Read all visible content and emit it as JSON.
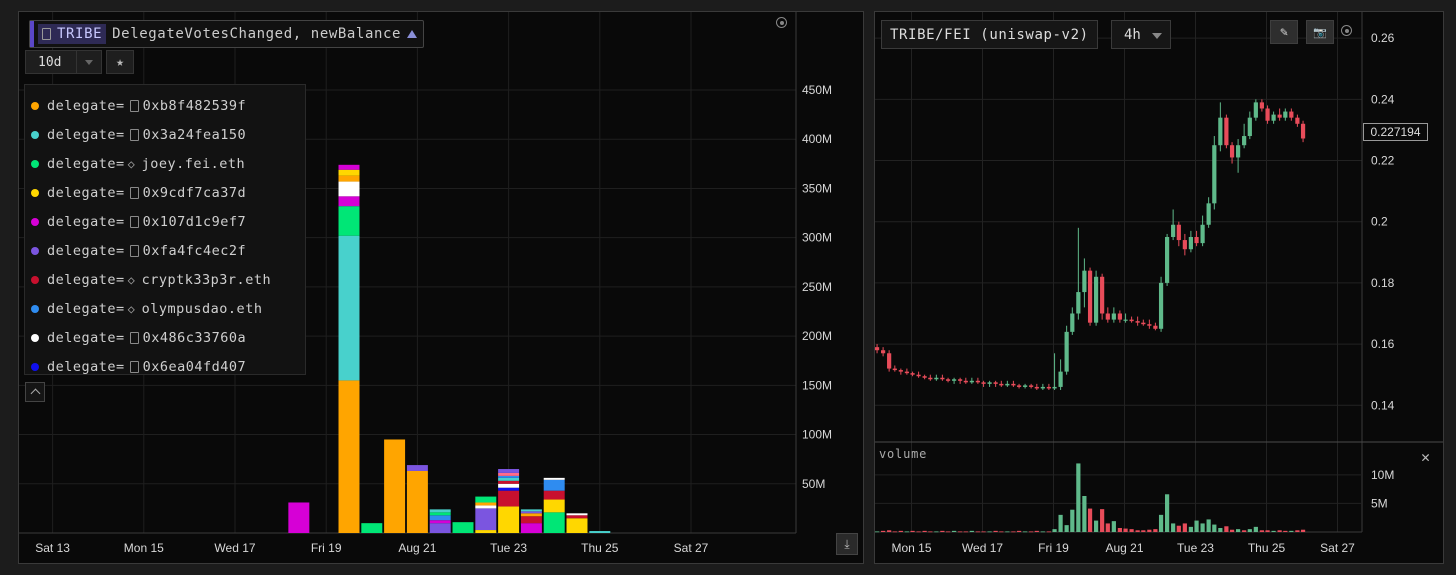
{
  "left": {
    "title": {
      "token": "TRIBE",
      "event": "DelegateVotesChanged, newBalance"
    },
    "range": "10d",
    "legend": [
      {
        "prefix": "delegate=",
        "icon": "file",
        "label": "0xb8f482539f",
        "color": "#ffa500"
      },
      {
        "prefix": "delegate=",
        "icon": "file",
        "label": "0x3a24fea150",
        "color": "#48d1cc"
      },
      {
        "prefix": "delegate=",
        "icon": "code",
        "label": "joey.fei.eth",
        "color": "#00e676"
      },
      {
        "prefix": "delegate=",
        "icon": "file",
        "label": "0x9cdf7ca37d",
        "color": "#ffd700"
      },
      {
        "prefix": "delegate=",
        "icon": "file",
        "label": "0x107d1c9ef7",
        "color": "#d600d6"
      },
      {
        "prefix": "delegate=",
        "icon": "file",
        "label": "0xfa4fc4ec2f",
        "color": "#7b55e0"
      },
      {
        "prefix": "delegate=",
        "icon": "code",
        "label": "cryptk33p3r.eth",
        "color": "#c8102e"
      },
      {
        "prefix": "delegate=",
        "icon": "code",
        "label": "olympusdao.eth",
        "color": "#2f8cf0"
      },
      {
        "prefix": "delegate=",
        "icon": "file",
        "label": "0x486c33760a",
        "color": "#ffffff"
      },
      {
        "prefix": "delegate=",
        "icon": "file",
        "label": "0x6ea04fd407",
        "color": "#1010ee"
      }
    ]
  },
  "right": {
    "pair": "TRIBE/FEI (uniswap-v2)",
    "timeframe": "4h",
    "last_price": "0.227194",
    "volume_label": "volume"
  },
  "chart_data": [
    {
      "type": "bar",
      "stacked": true,
      "x_ticks": [
        "Sat 13",
        "Mon 15",
        "Wed 17",
        "Fri 19",
        "Aug 21",
        "Tue 23",
        "Thu 25",
        "Sat 27"
      ],
      "y_ticks": [
        "50M",
        "100M",
        "150M",
        "200M",
        "250M",
        "300M",
        "350M",
        "400M",
        "450M"
      ],
      "ylim": [
        0,
        450
      ],
      "y_unit": "M",
      "xlim": [
        12,
        28
      ],
      "bar_width_days": 0.46,
      "bars": [
        {
          "x": 18.4,
          "stack": [
            [
              "#d600d6",
              31
            ]
          ]
        },
        {
          "x": 19.5,
          "stack": [
            [
              "#ffa500",
              155
            ],
            [
              "#48d1cc",
              147
            ],
            [
              "#00e676",
              30
            ],
            [
              "#d600d6",
              10
            ],
            [
              "#ffffff",
              15
            ],
            [
              "#ffa500",
              6
            ],
            [
              "#ffd700",
              6
            ],
            [
              "#d600d6",
              5
            ]
          ]
        },
        {
          "x": 20.0,
          "stack": [
            [
              "#00e676",
              10
            ]
          ]
        },
        {
          "x": 20.5,
          "stack": [
            [
              "#ffa500",
              95
            ]
          ]
        },
        {
          "x": 21.0,
          "stack": [
            [
              "#ffa500",
              63
            ],
            [
              "#7b55e0",
              6
            ]
          ]
        },
        {
          "x": 21.5,
          "stack": [
            [
              "#7b55e0",
              10
            ],
            [
              "#d600d6",
              3
            ],
            [
              "#2f8cf0",
              5
            ],
            [
              "#00e676",
              3
            ],
            [
              "#48d1cc",
              3
            ]
          ]
        },
        {
          "x": 22.0,
          "stack": [
            [
              "#00e676",
              11
            ]
          ]
        },
        {
          "x": 22.5,
          "stack": [
            [
              "#ffd700",
              3
            ],
            [
              "#7b55e0",
              22
            ],
            [
              "#ffffff",
              3
            ],
            [
              "#ffa500",
              3
            ],
            [
              "#00e676",
              6
            ]
          ]
        },
        {
          "x": 23.0,
          "stack": [
            [
              "#ffd700",
              27
            ],
            [
              "#c8102e",
              16
            ],
            [
              "#1010ee",
              3
            ],
            [
              "#ffffff",
              4
            ],
            [
              "#c8102e",
              3
            ],
            [
              "#48d1cc",
              3
            ],
            [
              "#2f8cf0",
              2
            ],
            [
              "#ff6b8b",
              3
            ],
            [
              "#7b55e0",
              4
            ]
          ]
        },
        {
          "x": 23.5,
          "stack": [
            [
              "#d600d6",
              10
            ],
            [
              "#c8102e",
              7
            ],
            [
              "#ffa500",
              3
            ],
            [
              "#7b55e0",
              2
            ],
            [
              "#48d1cc",
              2
            ]
          ]
        },
        {
          "x": 24.0,
          "stack": [
            [
              "#00e676",
              21
            ],
            [
              "#ffd700",
              13
            ],
            [
              "#c8102e",
              9
            ],
            [
              "#2f8cf0",
              11
            ],
            [
              "#ffffff",
              2
            ]
          ]
        },
        {
          "x": 24.5,
          "stack": [
            [
              "#ffd700",
              15
            ],
            [
              "#c8102e",
              3
            ],
            [
              "#ffffff",
              2
            ]
          ]
        },
        {
          "x": 25.0,
          "stack": [
            [
              "#48d1cc",
              2
            ]
          ]
        }
      ]
    },
    {
      "type": "candlestick",
      "x_ticks": [
        "Mon 15",
        "Wed 17",
        "Fri 19",
        "Aug 21",
        "Tue 23",
        "Thu 25",
        "Sat 27"
      ],
      "y_ticks": [
        0.14,
        0.16,
        0.18,
        0.2,
        0.22,
        0.24,
        0.26
      ],
      "ylim": [
        0.128,
        0.262
      ],
      "xlim": [
        14,
        27.72
      ],
      "last_price": 0.227194,
      "up_color": "#5fb98a",
      "down_color": "#e84c5a",
      "candles": [
        [
          14.03,
          0.159,
          0.158,
          0.16,
          0.157
        ],
        [
          14.2,
          0.158,
          0.157,
          0.159,
          0.156
        ],
        [
          14.37,
          0.157,
          0.152,
          0.158,
          0.151
        ],
        [
          14.53,
          0.152,
          0.1515,
          0.153,
          0.151
        ],
        [
          14.7,
          0.1515,
          0.151,
          0.152,
          0.15
        ],
        [
          14.87,
          0.151,
          0.1505,
          0.152,
          0.15
        ],
        [
          15.03,
          0.1505,
          0.15,
          0.151,
          0.1495
        ],
        [
          15.2,
          0.15,
          0.1495,
          0.151,
          0.149
        ],
        [
          15.37,
          0.1495,
          0.149,
          0.15,
          0.1485
        ],
        [
          15.53,
          0.149,
          0.1485,
          0.15,
          0.148
        ],
        [
          15.7,
          0.1485,
          0.149,
          0.15,
          0.148
        ],
        [
          15.87,
          0.149,
          0.1485,
          0.15,
          0.148
        ],
        [
          16.03,
          0.1485,
          0.148,
          0.149,
          0.1475
        ],
        [
          16.2,
          0.148,
          0.1485,
          0.149,
          0.147
        ],
        [
          16.37,
          0.1485,
          0.148,
          0.149,
          0.147
        ],
        [
          16.53,
          0.148,
          0.1475,
          0.149,
          0.147
        ],
        [
          16.7,
          0.1475,
          0.148,
          0.149,
          0.147
        ],
        [
          16.87,
          0.148,
          0.1475,
          0.149,
          0.147
        ],
        [
          17.03,
          0.1475,
          0.147,
          0.148,
          0.146
        ],
        [
          17.2,
          0.147,
          0.1475,
          0.148,
          0.146
        ],
        [
          17.37,
          0.1475,
          0.147,
          0.148,
          0.146
        ],
        [
          17.53,
          0.147,
          0.1465,
          0.148,
          0.146
        ],
        [
          17.7,
          0.1465,
          0.147,
          0.148,
          0.146
        ],
        [
          17.87,
          0.147,
          0.1465,
          0.148,
          0.146
        ],
        [
          18.03,
          0.1465,
          0.146,
          0.147,
          0.1455
        ],
        [
          18.2,
          0.146,
          0.1465,
          0.147,
          0.1455
        ],
        [
          18.37,
          0.1465,
          0.146,
          0.147,
          0.1455
        ],
        [
          18.53,
          0.146,
          0.1455,
          0.147,
          0.145
        ],
        [
          18.7,
          0.1455,
          0.146,
          0.147,
          0.145
        ],
        [
          18.87,
          0.146,
          0.1455,
          0.147,
          0.145
        ],
        [
          19.03,
          0.1455,
          0.146,
          0.157,
          0.145
        ],
        [
          19.2,
          0.146,
          0.151,
          0.155,
          0.145
        ],
        [
          19.37,
          0.151,
          0.164,
          0.166,
          0.15
        ],
        [
          19.53,
          0.164,
          0.17,
          0.172,
          0.163
        ],
        [
          19.7,
          0.17,
          0.177,
          0.198,
          0.168
        ],
        [
          19.87,
          0.177,
          0.184,
          0.188,
          0.172
        ],
        [
          20.03,
          0.184,
          0.167,
          0.185,
          0.166
        ],
        [
          20.2,
          0.167,
          0.182,
          0.184,
          0.166
        ],
        [
          20.37,
          0.182,
          0.17,
          0.183,
          0.168
        ],
        [
          20.53,
          0.17,
          0.168,
          0.172,
          0.167
        ],
        [
          20.7,
          0.168,
          0.17,
          0.172,
          0.167
        ],
        [
          20.87,
          0.17,
          0.168,
          0.171,
          0.167
        ],
        [
          21.03,
          0.168,
          0.168,
          0.17,
          0.167
        ],
        [
          21.2,
          0.168,
          0.1675,
          0.169,
          0.167
        ],
        [
          21.37,
          0.1675,
          0.167,
          0.169,
          0.166
        ],
        [
          21.53,
          0.167,
          0.1665,
          0.168,
          0.166
        ],
        [
          21.7,
          0.1665,
          0.166,
          0.168,
          0.165
        ],
        [
          21.87,
          0.166,
          0.165,
          0.167,
          0.1645
        ],
        [
          22.03,
          0.165,
          0.18,
          0.182,
          0.164
        ],
        [
          22.2,
          0.18,
          0.195,
          0.196,
          0.179
        ],
        [
          22.37,
          0.195,
          0.199,
          0.204,
          0.194
        ],
        [
          22.53,
          0.199,
          0.194,
          0.2,
          0.192
        ],
        [
          22.7,
          0.194,
          0.191,
          0.196,
          0.189
        ],
        [
          22.87,
          0.191,
          0.195,
          0.197,
          0.19
        ],
        [
          23.03,
          0.195,
          0.193,
          0.197,
          0.192
        ],
        [
          23.2,
          0.193,
          0.199,
          0.202,
          0.192
        ],
        [
          23.37,
          0.199,
          0.206,
          0.208,
          0.198
        ],
        [
          23.53,
          0.206,
          0.225,
          0.228,
          0.204
        ],
        [
          23.7,
          0.225,
          0.234,
          0.239,
          0.223
        ],
        [
          23.87,
          0.234,
          0.225,
          0.235,
          0.224
        ],
        [
          24.03,
          0.225,
          0.221,
          0.226,
          0.219
        ],
        [
          24.2,
          0.221,
          0.225,
          0.227,
          0.216
        ],
        [
          24.37,
          0.225,
          0.228,
          0.232,
          0.224
        ],
        [
          24.53,
          0.228,
          0.234,
          0.236,
          0.227
        ],
        [
          24.7,
          0.234,
          0.239,
          0.24,
          0.233
        ],
        [
          24.87,
          0.239,
          0.237,
          0.24,
          0.236
        ],
        [
          25.03,
          0.237,
          0.233,
          0.238,
          0.232
        ],
        [
          25.2,
          0.233,
          0.235,
          0.236,
          0.232
        ],
        [
          25.37,
          0.235,
          0.234,
          0.237,
          0.233
        ],
        [
          25.53,
          0.234,
          0.236,
          0.237,
          0.233
        ],
        [
          25.7,
          0.236,
          0.234,
          0.237,
          0.233
        ],
        [
          25.87,
          0.234,
          0.232,
          0.235,
          0.231
        ],
        [
          26.03,
          0.232,
          0.2272,
          0.233,
          0.226
        ]
      ]
    },
    {
      "type": "bar",
      "title": "volume",
      "y_ticks": [
        "5M",
        "10M"
      ],
      "ylim": [
        0,
        14
      ],
      "y_unit": "M",
      "xlim": [
        14,
        27.72
      ],
      "bars": [
        [
          14.03,
          0.1,
          0
        ],
        [
          14.2,
          0.2,
          1
        ],
        [
          14.37,
          0.3,
          1
        ],
        [
          14.53,
          0.1,
          1
        ],
        [
          14.7,
          0.2,
          1
        ],
        [
          14.87,
          0.1,
          0
        ],
        [
          15.03,
          0.2,
          1
        ],
        [
          15.2,
          0.1,
          1
        ],
        [
          15.37,
          0.2,
          1
        ],
        [
          15.53,
          0.1,
          1
        ],
        [
          15.7,
          0.1,
          0
        ],
        [
          15.87,
          0.2,
          1
        ],
        [
          16.03,
          0.1,
          1
        ],
        [
          16.2,
          0.2,
          0
        ],
        [
          16.37,
          0.1,
          1
        ],
        [
          16.53,
          0.1,
          1
        ],
        [
          16.7,
          0.2,
          0
        ],
        [
          16.87,
          0.1,
          1
        ],
        [
          17.03,
          0.1,
          1
        ],
        [
          17.2,
          0.1,
          0
        ],
        [
          17.37,
          0.2,
          1
        ],
        [
          17.53,
          0.1,
          1
        ],
        [
          17.7,
          0.1,
          0
        ],
        [
          17.87,
          0.1,
          1
        ],
        [
          18.03,
          0.2,
          1
        ],
        [
          18.2,
          0.1,
          0
        ],
        [
          18.37,
          0.1,
          1
        ],
        [
          18.53,
          0.2,
          1
        ],
        [
          18.7,
          0.1,
          0
        ],
        [
          18.87,
          0.1,
          1
        ],
        [
          19.03,
          0.5,
          0
        ],
        [
          19.2,
          3.0,
          0
        ],
        [
          19.37,
          1.2,
          0
        ],
        [
          19.53,
          3.9,
          0
        ],
        [
          19.7,
          12.0,
          0
        ],
        [
          19.87,
          6.3,
          0
        ],
        [
          20.03,
          4.1,
          1
        ],
        [
          20.2,
          2.0,
          0
        ],
        [
          20.37,
          4.0,
          1
        ],
        [
          20.53,
          1.5,
          1
        ],
        [
          20.7,
          1.9,
          0
        ],
        [
          20.87,
          0.7,
          1
        ],
        [
          21.03,
          0.6,
          1
        ],
        [
          21.2,
          0.5,
          1
        ],
        [
          21.37,
          0.3,
          1
        ],
        [
          21.53,
          0.3,
          1
        ],
        [
          21.7,
          0.4,
          1
        ],
        [
          21.87,
          0.5,
          1
        ],
        [
          22.03,
          3.0,
          0
        ],
        [
          22.2,
          6.6,
          0
        ],
        [
          22.37,
          1.5,
          0
        ],
        [
          22.53,
          1.1,
          1
        ],
        [
          22.7,
          1.5,
          1
        ],
        [
          22.87,
          0.9,
          0
        ],
        [
          23.03,
          2.0,
          0
        ],
        [
          23.2,
          1.5,
          0
        ],
        [
          23.37,
          2.2,
          0
        ],
        [
          23.53,
          1.3,
          0
        ],
        [
          23.7,
          0.7,
          0
        ],
        [
          23.87,
          1.0,
          1
        ],
        [
          24.03,
          0.4,
          1
        ],
        [
          24.2,
          0.5,
          0
        ],
        [
          24.37,
          0.3,
          1
        ],
        [
          24.53,
          0.5,
          0
        ],
        [
          24.7,
          0.9,
          0
        ],
        [
          24.87,
          0.3,
          1
        ],
        [
          25.03,
          0.3,
          1
        ],
        [
          25.2,
          0.2,
          0
        ],
        [
          25.37,
          0.3,
          1
        ],
        [
          25.53,
          0.2,
          1
        ],
        [
          25.7,
          0.2,
          0
        ],
        [
          25.87,
          0.3,
          1
        ],
        [
          26.03,
          0.4,
          1
        ]
      ]
    }
  ]
}
